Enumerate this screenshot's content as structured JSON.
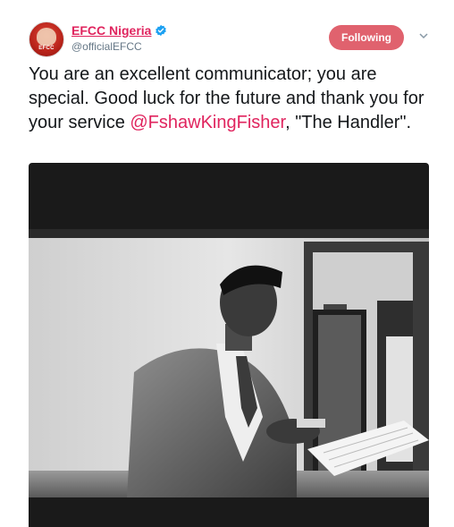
{
  "user": {
    "display_name": "EFCC Nigeria",
    "handle": "@officialEFCC",
    "avatar_text": "EFCC",
    "verified_icon": "verified-badge-icon"
  },
  "follow_button": {
    "label": "Following"
  },
  "menu": {
    "caret_icon": "chevron-down-icon"
  },
  "tweet": {
    "text_before": "You are an excellent communicator; you are special. Good luck for the future and thank you for your service ",
    "mention": "@FshawKingFisher",
    "text_after": ", \"The Handler\"."
  },
  "colors": {
    "accent": "#e0245e",
    "follow_bg": "#e0626e",
    "verified": "#1da1f2",
    "handle": "#657786"
  }
}
